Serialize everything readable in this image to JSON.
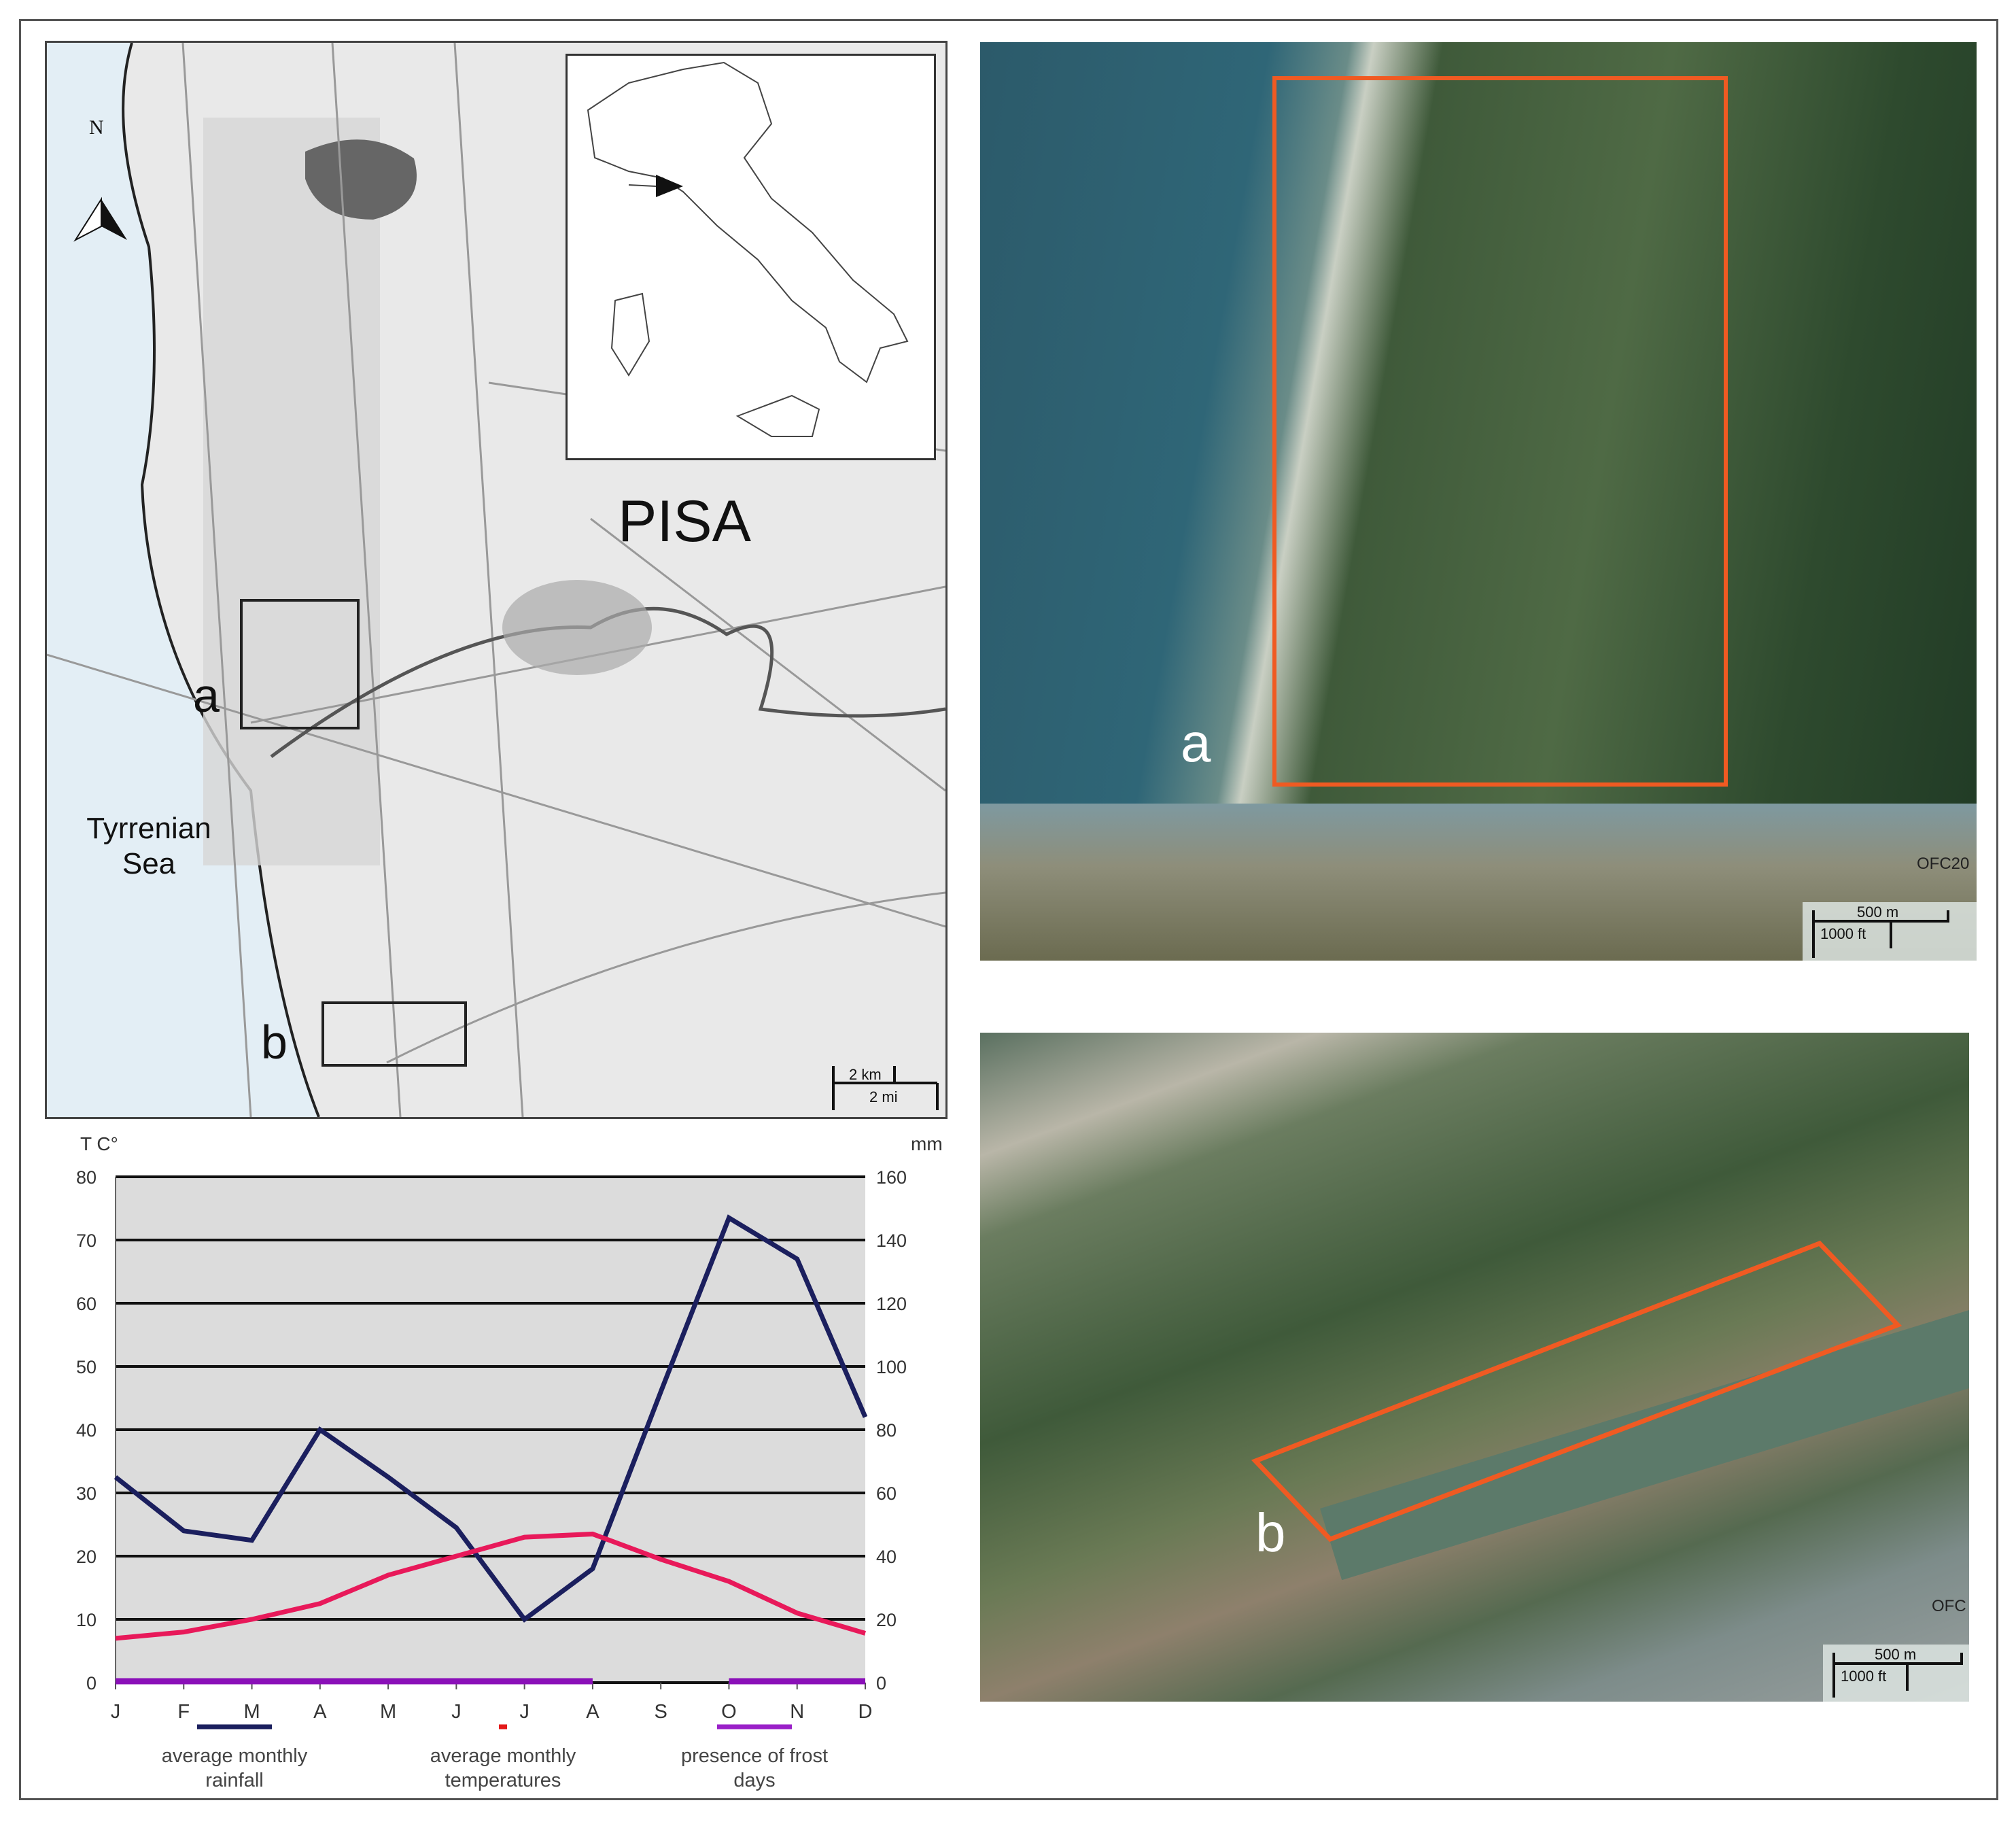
{
  "map": {
    "city_label": "PISA",
    "sea_label_line1": "Tyrrenian",
    "sea_label_line2": "Sea",
    "north_label": "N",
    "site_a_label": "a",
    "site_b_label": "b",
    "scale_km": "2 km",
    "scale_mi": "2 mi"
  },
  "satellite_a": {
    "site_label": "a",
    "watermark": "OFC20",
    "scale_m": "500 m",
    "scale_ft": "1000 ft",
    "highlight_color": "#f05a22"
  },
  "satellite_b": {
    "site_label": "b",
    "watermark": "OFC",
    "scale_m": "500 m",
    "scale_ft": "1000 ft",
    "highlight_color": "#f05a22"
  },
  "chart_data": {
    "type": "line",
    "title": "",
    "ylabel_left": "T C°",
    "ylabel_right": "mm",
    "ylim_left": [
      0,
      80
    ],
    "ylim_right": [
      0,
      160
    ],
    "yticks_left": [
      "0",
      "10",
      "20",
      "30",
      "40",
      "50",
      "60",
      "70",
      "80"
    ],
    "yticks_right": [
      "0",
      "20",
      "40",
      "60",
      "80",
      "100",
      "120",
      "140",
      "160"
    ],
    "grid": true,
    "categories": [
      "J",
      "F",
      "M",
      "A",
      "M",
      "J",
      "J",
      "A",
      "S",
      "O",
      "N",
      "D"
    ],
    "series": [
      {
        "name": "average monthly rainfall",
        "axis": "right",
        "color": "#1b1f5e",
        "values": [
          65,
          48,
          45,
          80,
          65,
          49,
          20,
          36,
          92,
          147,
          134,
          84
        ]
      },
      {
        "name": "average monthly temperatures",
        "axis": "left",
        "color": "#e8195a",
        "values": [
          7,
          8,
          10,
          12.5,
          17,
          20,
          23,
          23.5,
          19.5,
          16,
          11,
          7.8
        ]
      }
    ],
    "frost_days": {
      "name": "presence of frost days",
      "color": "#8a10b8",
      "ranges": [
        [
          "J",
          "A"
        ],
        [
          "O",
          "D"
        ]
      ]
    },
    "legend": [
      {
        "line1": "average monthly",
        "line2": "rainfall",
        "color": "#1b1f5e"
      },
      {
        "line1": "average monthly",
        "line2": "temperatures",
        "color": "#e41a1a"
      },
      {
        "line1": "presence of frost",
        "line2": "days",
        "color": "#9a20c8"
      }
    ],
    "legend_position": "bottom"
  }
}
